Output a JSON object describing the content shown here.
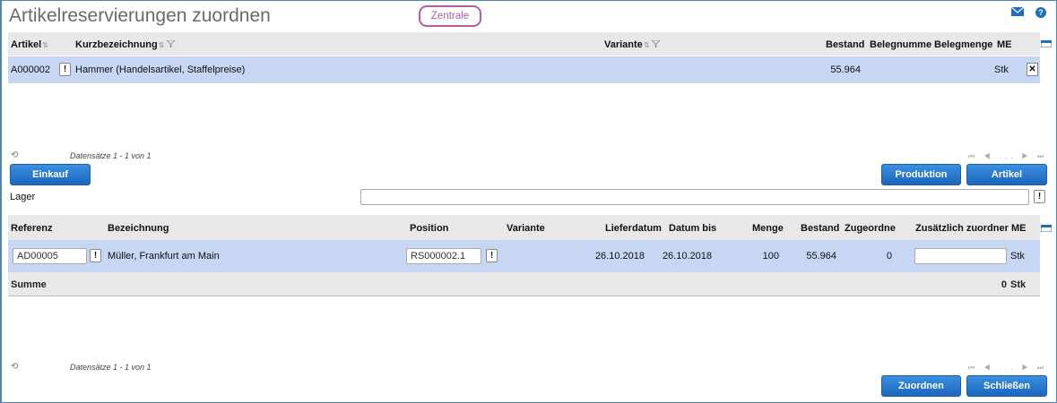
{
  "header": {
    "title": "Artikelreservierungen zuordnen",
    "company": "Zentrale",
    "mail_icon": "mail-icon",
    "help_icon": "help-icon",
    "help_symbol": "?"
  },
  "article_grid": {
    "columns": {
      "artikel": "Artikel",
      "kurzbezeichnung": "Kurzbezeichnung",
      "variante": "Variante",
      "bestand": "Bestand",
      "belegnummer": "Belegnumme",
      "belegmenge": "Belegmenge",
      "me": "ME"
    },
    "rows": [
      {
        "artikel": "A000002",
        "kurzbezeichnung": "Hammer (Handelsartikel, Staffelpreise)",
        "variante": "",
        "bestand": "55.964",
        "belegnummer": "",
        "belegmenge": "",
        "me": "Stk"
      }
    ],
    "records_info": "Datensätze 1 - 1 von 1",
    "pager": "⏮ ◀ ... ▶ ⏭"
  },
  "buttons": {
    "einkauf": "Einkauf",
    "produktion": "Produktion",
    "artikel": "Artikel",
    "zuordnen": "Zuordnen",
    "schliessen": "Schließen",
    "exclam": "!",
    "close": "✕"
  },
  "lager": {
    "label": "Lager",
    "value": ""
  },
  "reservation_grid": {
    "columns": {
      "referenz": "Referenz",
      "bezeichnung": "Bezeichnung",
      "position": "Position",
      "variante": "Variante",
      "lieferdatum": "Lieferdatum",
      "datum_bis": "Datum bis",
      "menge": "Menge",
      "bestand": "Bestand",
      "zugeordnet": "Zugeordne",
      "zusaetzlich": "Zusätzlich zuordner",
      "me": "ME"
    },
    "rows": [
      {
        "referenz": "AD00005",
        "bezeichnung": "Müller, Frankfurt am Main",
        "position": "RS000002.1",
        "variante": "",
        "lieferdatum": "26.10.2018",
        "datum_bis": "26.10.2018",
        "menge": "100",
        "bestand": "55.964",
        "zugeordnet": "0",
        "zusaetzlich": "",
        "me": "Stk"
      }
    ],
    "sum": {
      "label": "Summe",
      "value": "0",
      "me": "Stk"
    },
    "records_info": "Datensätze 1 - 1 von 1",
    "pager": "⏮ ◀ ... ▶ ⏭"
  },
  "colors": {
    "accent": "#1b66bf",
    "row_selected": "#c6d6f3",
    "header_bg": "#e8e8e8",
    "badge": "#b85aa0"
  }
}
